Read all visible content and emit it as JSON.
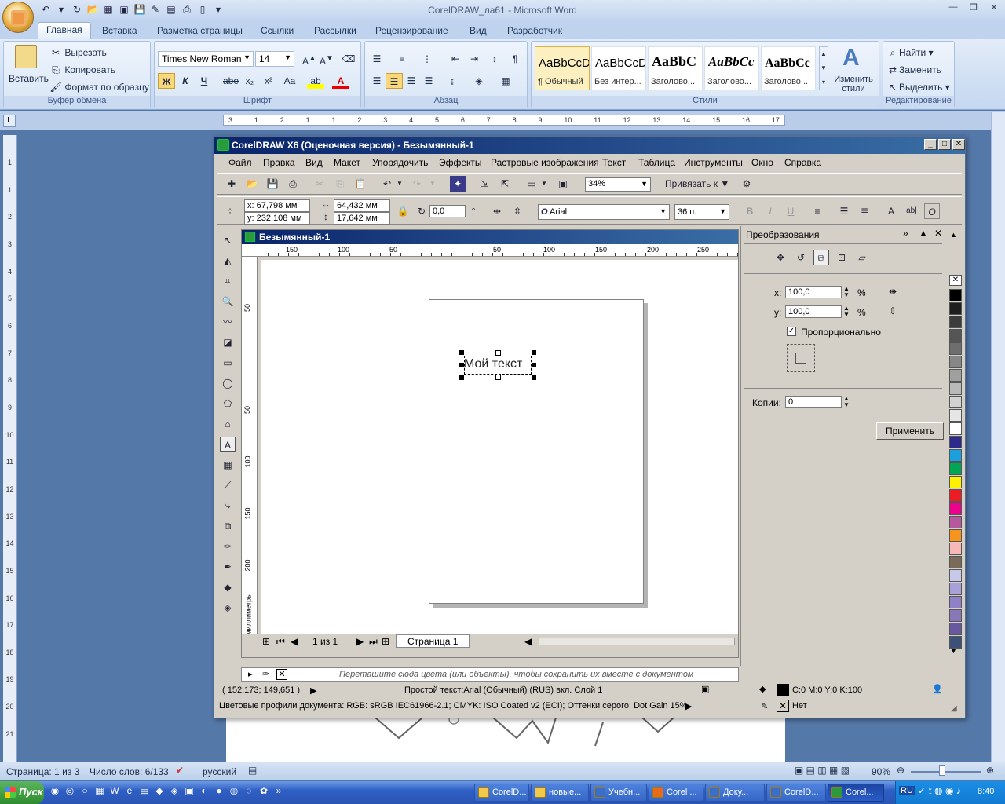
{
  "word": {
    "title": "CorelDRAW_ла61 - Microsoft Word",
    "tabs": [
      "Главная",
      "Вставка",
      "Разметка страницы",
      "Ссылки",
      "Рассылки",
      "Рецензирование",
      "Вид",
      "Разработчик"
    ],
    "clipboard": {
      "paste": "Вставить",
      "cut": "Вырезать",
      "copy": "Копировать",
      "format_painter": "Формат по образцу",
      "label": "Буфер обмена"
    },
    "font": {
      "name": "Times New Roman",
      "size": "14",
      "label": "Шрифт",
      "bold": "Ж",
      "italic": "К",
      "underline": "Ч",
      "strike": "abe",
      "sub": "x₂",
      "sup": "x²",
      "case": "Aa"
    },
    "paragraph": {
      "label": "Абзац"
    },
    "styles": {
      "label": "Стили",
      "change": "Изменить стили",
      "items": [
        {
          "preview": "AaBbCcD",
          "name": "¶ Обычный"
        },
        {
          "preview": "AaBbCcD",
          "name": "Без интер..."
        },
        {
          "preview": "AaBbC",
          "name": "Заголово..."
        },
        {
          "preview": "AaBbCc",
          "name": "Заголово..."
        },
        {
          "preview": "AaBbCc",
          "name": "Заголово..."
        }
      ]
    },
    "editing": {
      "find": "Найти",
      "replace": "Заменить",
      "select": "Выделить",
      "label": "Редактирование"
    },
    "ruler_marks": [
      "3",
      "1",
      "2",
      "1",
      "1",
      "2",
      "3",
      "4",
      "5",
      "6",
      "7",
      "8",
      "9",
      "10",
      "11",
      "12",
      "13",
      "14",
      "15",
      "16",
      "17"
    ],
    "vruler_marks": [
      "1",
      "1",
      "2",
      "3",
      "4",
      "5",
      "6",
      "7",
      "8",
      "9",
      "10",
      "11",
      "12",
      "13",
      "14",
      "15",
      "16",
      "17",
      "18",
      "19",
      "20",
      "21"
    ],
    "status": {
      "page": "Страница: 1 из 3",
      "words": "Число слов: 6/133",
      "lang": "русский",
      "zoom": "90%"
    }
  },
  "taskbar": {
    "start": "Пуск",
    "tasks": [
      "CorelD...",
      "новые...",
      "Учебн...",
      "Corel ...",
      "Доку...",
      "CorelD...",
      "Corel..."
    ],
    "tray_lang": "RU",
    "time": "8:40"
  },
  "corel": {
    "title": "CorelDRAW X6 (Оценочная версия) - Безымянный-1",
    "menu": [
      "Файл",
      "Правка",
      "Вид",
      "Макет",
      "Упорядочить",
      "Эффекты",
      "Растровые изображения",
      "Текст",
      "Таблица",
      "Инструменты",
      "Окно",
      "Справка"
    ],
    "zoom": "34%",
    "snap": "Привязать к",
    "x": "x: 67,798 мм",
    "y": "y: 232,108 мм",
    "w": "64,432 мм",
    "h": "17,642 мм",
    "angle": "0,0",
    "angle_unit": "°",
    "font_name": "Arial",
    "font_size": "36 п.",
    "doc_title": "Безымянный-1",
    "hruler": [
      "150",
      "100",
      "50",
      "50",
      "100",
      "150",
      "200",
      "250"
    ],
    "vruler": [
      "50",
      "50",
      "100",
      "150",
      "200"
    ],
    "vruler_unit": "миллиметры",
    "canvas_text": "Мой текст",
    "page_counter": "1 из 1",
    "page_tab": "Страница 1",
    "palette_hint": "Перетащите сюда цвета (или объекты), чтобы сохранить их вместе с документом",
    "docker": {
      "title": "Преобразования",
      "x_label": "x:",
      "x_val": "100,0",
      "y_label": "y:",
      "y_val": "100,0",
      "pct": "%",
      "proportional": "Пропорционально",
      "copies_label": "Копии:",
      "copies_val": "0",
      "apply": "Применить"
    },
    "status": {
      "coords": "( 152,173; 149,651 )",
      "info": "Простой текст:Arial (Обычный) (RUS) вкл. Слой 1",
      "fill": "C:0 M:0 Y:0 K:100",
      "outline": "Нет",
      "profiles": "Цветовые профили документа: RGB: sRGB IEC61966-2.1; CMYK: ISO Coated v2 (ECI); Оттенки серого: Dot Gain 15%"
    },
    "swatches": [
      "#000000",
      "#1e1e1e",
      "#3c3c3c",
      "#555555",
      "#6e6e6e",
      "#878787",
      "#a0a0a0",
      "#b9b9b9",
      "#d2d2d2",
      "#e6e6e6",
      "#ffffff",
      "#2e2a8c",
      "#1aa0dc",
      "#00a651",
      "#fff200",
      "#ed1c24",
      "#ec008c",
      "#b5589c",
      "#f7941d",
      "#f9b8b8",
      "#7a6a5a",
      "#c8c8e8",
      "#a8a0d8",
      "#9080c8",
      "#8878b8",
      "#6858a0",
      "#3c5078"
    ]
  }
}
